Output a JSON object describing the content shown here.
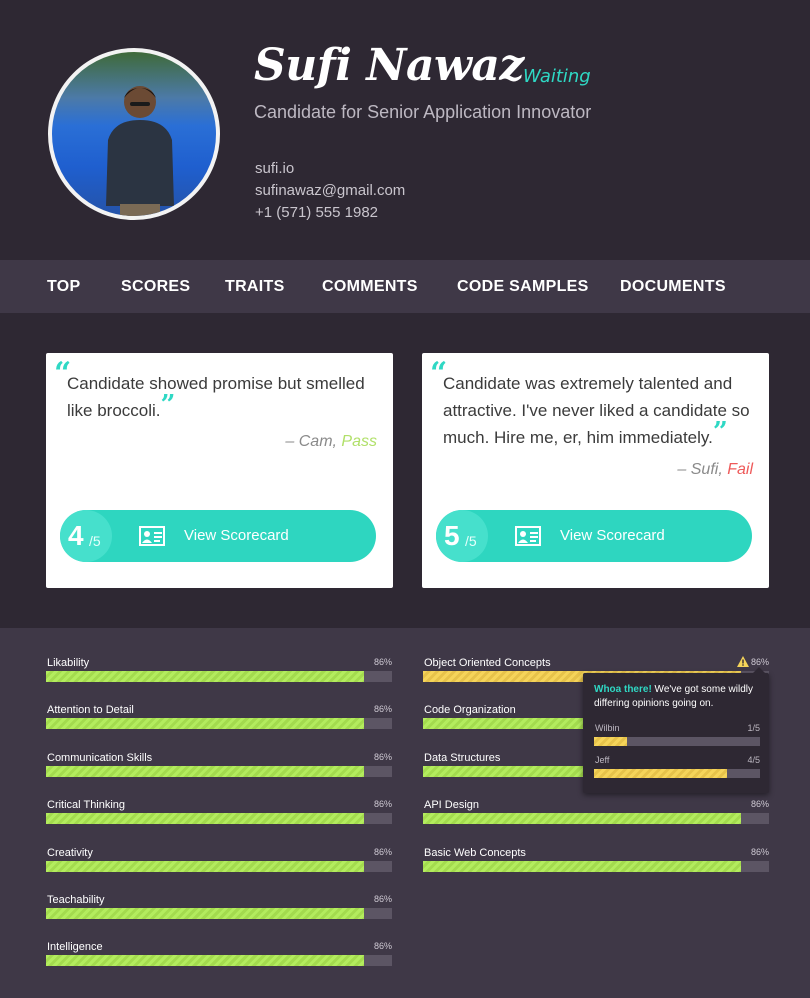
{
  "profile": {
    "name": "Sufi Nawaz",
    "status": "Waiting",
    "subtitle": "Candidate for Senior Application Innovator",
    "website": "sufi.io",
    "email": "sufinawaz@gmail.com",
    "phone": "+1 (571) 555 1982"
  },
  "nav": [
    "TOP",
    "SCORES",
    "TRAITS",
    "COMMENTS",
    "CODE SAMPLES",
    "DOCUMENTS"
  ],
  "cards": [
    {
      "quote": "Candidate showed promise but smelled like broccoli.",
      "author": "Cam",
      "verdict": "Pass",
      "score": "4",
      "out_of": "/5",
      "button": "View Scorecard"
    },
    {
      "quote": "Candidate was extremely talented and attractive. I've never liked a candidate so much. Hire me, er, him immediately.",
      "author": "Sufi",
      "verdict": "Fail",
      "score": "5",
      "out_of": "/5",
      "button": "View Scorecard"
    }
  ],
  "skills_left": [
    {
      "label": "Likability",
      "pct": "86%",
      "value": 0.92
    },
    {
      "label": "Attention to Detail",
      "pct": "86%",
      "value": 0.92
    },
    {
      "label": "Communication Skills",
      "pct": "86%",
      "value": 0.92
    },
    {
      "label": "Critical Thinking",
      "pct": "86%",
      "value": 0.92
    },
    {
      "label": "Creativity",
      "pct": "86%",
      "value": 0.92
    },
    {
      "label": "Teachability",
      "pct": "86%",
      "value": 0.92
    },
    {
      "label": "Intelligence",
      "pct": "86%",
      "value": 0.92
    }
  ],
  "skills_right": [
    {
      "label": "Object Oriented Concepts",
      "pct": "86%",
      "value": 0.92,
      "warning": true
    },
    {
      "label": "Code Organization",
      "pct": "86%",
      "value": 0.92
    },
    {
      "label": "Data Structures",
      "pct": "86%",
      "value": 0.92
    },
    {
      "label": "API Design",
      "pct": "86%",
      "value": 0.92
    },
    {
      "label": "Basic Web Concepts",
      "pct": "86%",
      "value": 0.92
    }
  ],
  "tooltip": {
    "highlight": "Whoa there!",
    "message": " We've got some wildly differing opinions going on.",
    "votes": [
      {
        "name": "Wilbin",
        "score": "1/5",
        "value": 0.2
      },
      {
        "name": "Jeff",
        "score": "4/5",
        "value": 0.8
      }
    ]
  },
  "colors": {
    "accent": "#2fd8c4",
    "pass": "#b1e06a",
    "fail": "#ee5a5a",
    "bar_green": "#b3ec5e",
    "bar_yellow": "#f5d45a"
  }
}
